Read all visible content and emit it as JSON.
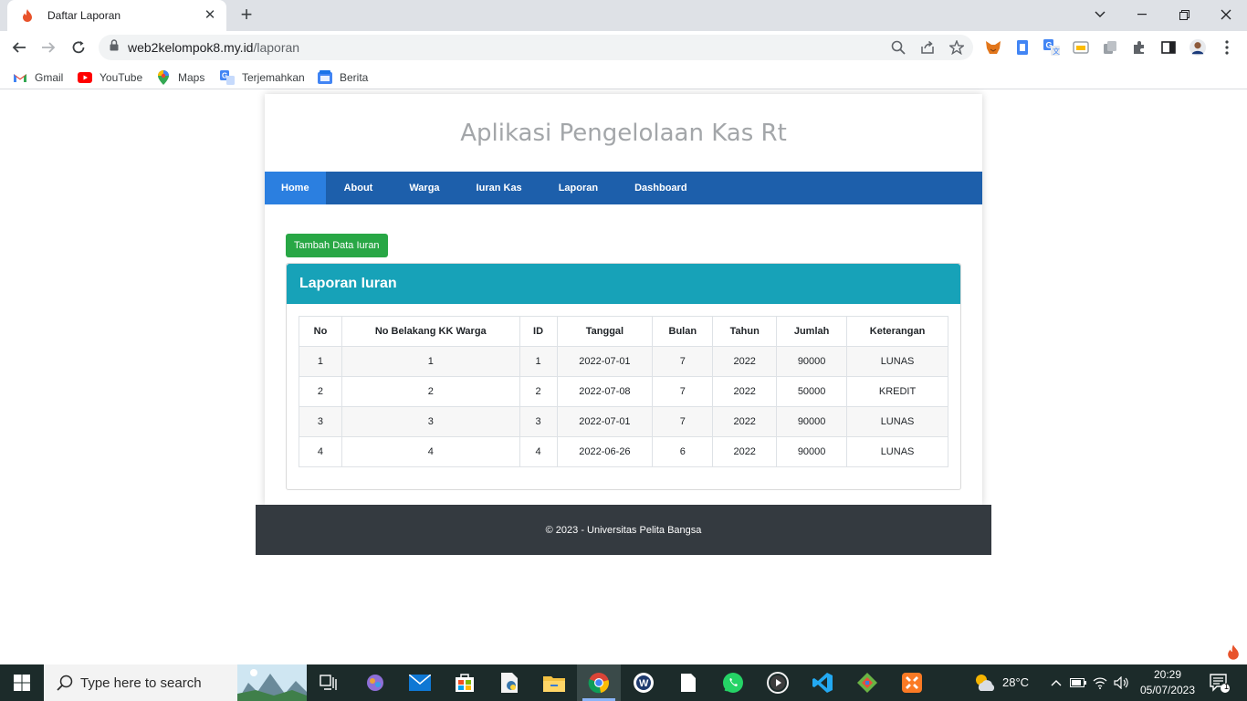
{
  "browser": {
    "tab_title": "Daftar Laporan",
    "url_host": "web2kelompok8.my.id",
    "url_path": "/laporan",
    "bookmarks": [
      "Gmail",
      "YouTube",
      "Maps",
      "Terjemahkan",
      "Berita"
    ]
  },
  "app": {
    "title": "Aplikasi Pengelolaan Kas Rt",
    "nav": [
      "Home",
      "About",
      "Warga",
      "Iuran Kas",
      "Laporan",
      "Dashboard"
    ],
    "active_nav": "Home",
    "add_button": "Tambah Data Iuran",
    "card_title": "Laporan Iuran",
    "table": {
      "headers": [
        "No",
        "No Belakang KK Warga",
        "ID",
        "Tanggal",
        "Bulan",
        "Tahun",
        "Jumlah",
        "Keterangan"
      ],
      "rows": [
        [
          "1",
          "1",
          "1",
          "2022-07-01",
          "7",
          "2022",
          "90000",
          "LUNAS"
        ],
        [
          "2",
          "2",
          "2",
          "2022-07-08",
          "7",
          "2022",
          "50000",
          "KREDIT"
        ],
        [
          "3",
          "3",
          "3",
          "2022-07-01",
          "7",
          "2022",
          "90000",
          "LUNAS"
        ],
        [
          "4",
          "4",
          "4",
          "2022-06-26",
          "6",
          "2022",
          "90000",
          "LUNAS"
        ]
      ]
    },
    "footer": "© 2023 - Universitas Pelita Bangsa"
  },
  "taskbar": {
    "search_placeholder": "Type here to search",
    "temperature": "28°C",
    "time": "20:29",
    "date": "05/07/2023",
    "notification_count": "1"
  },
  "colors": {
    "navbar": "#1d5fab",
    "nav_active": "#2b7fe0",
    "add_button": "#28a745",
    "card_header": "#17a2b8",
    "footer": "#343a40"
  }
}
